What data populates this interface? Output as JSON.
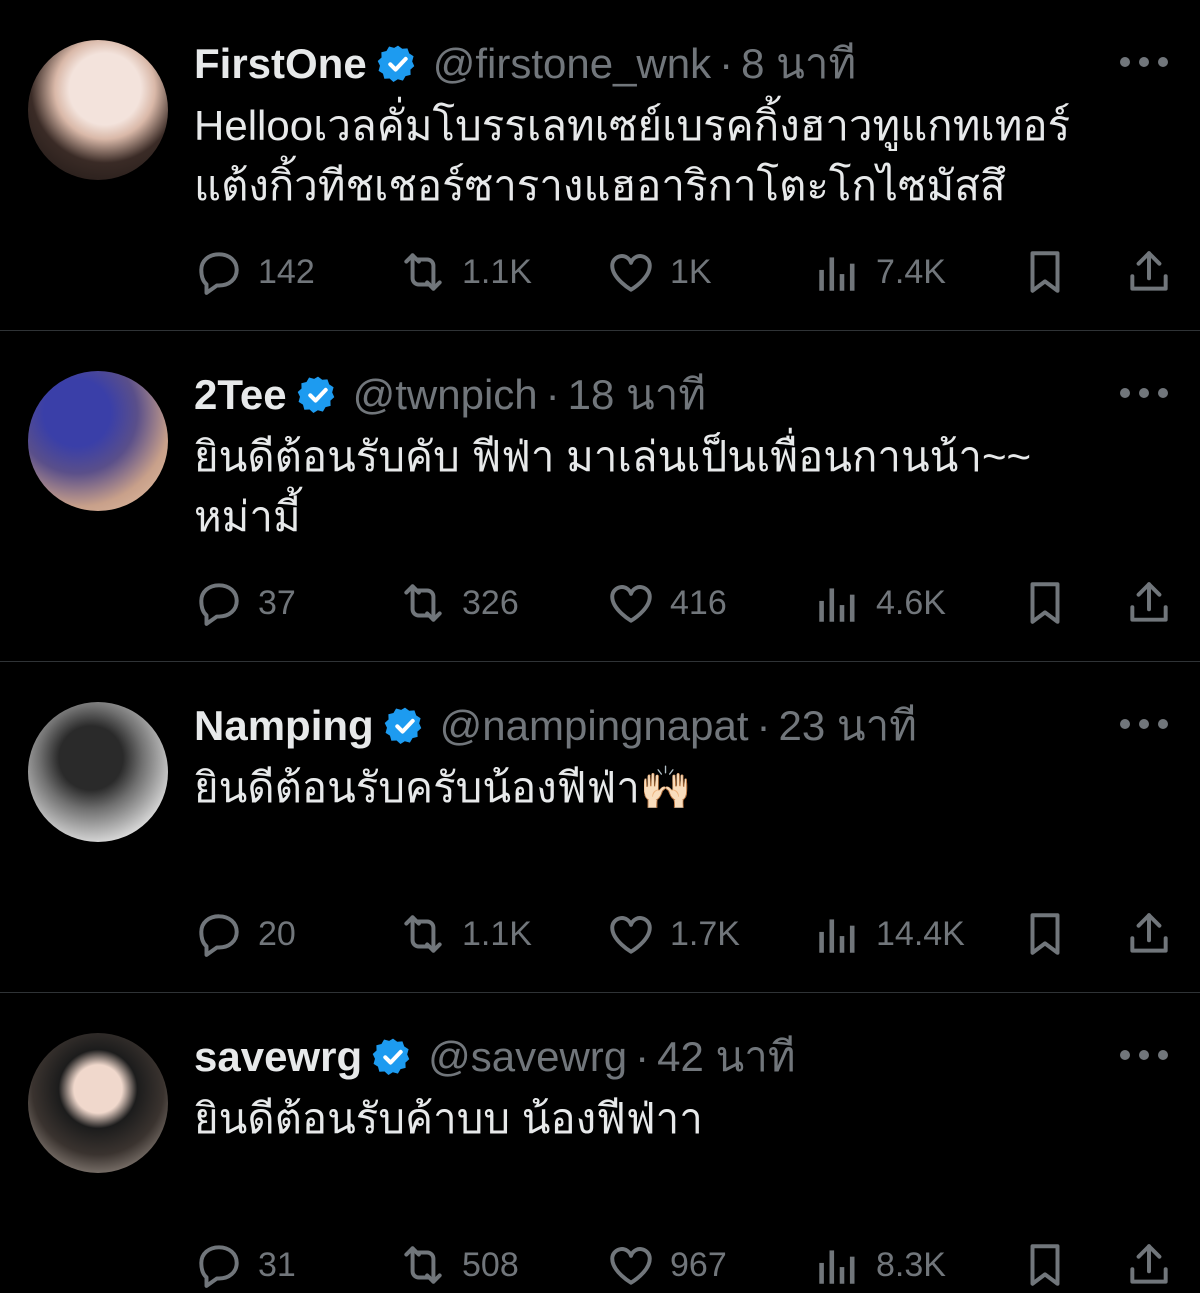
{
  "colors": {
    "background": "#000000",
    "text": "#e7e9ea",
    "muted": "#71767b",
    "verified": "#1d9bf0",
    "divider": "#2f3336"
  },
  "tweets": [
    {
      "name": "FirstOne",
      "handle": "@firstone_wnk",
      "separator": "·",
      "time": "8 นาที",
      "text_lines": [
        "Hellooเวลคั่มโบรรเลทเซย์เบรคกิ้งฮาวทูแกทเทอร์",
        "แต้งกิ้วทีชเชอร์ซารางแฮอาริกาโตะโกไซมัสสึ"
      ],
      "stats": {
        "replies": "142",
        "retweets": "1.1K",
        "likes": "1K",
        "views": "7.4K"
      }
    },
    {
      "name": "2Tee",
      "handle": "@twnpich",
      "separator": "·",
      "time": "18 นาที",
      "text_lines": [
        "ยินดีต้อนรับคับ ฟีฟ่า มาเล่นเป็นเพื่อนกานน้า~~",
        "หม่ามี้"
      ],
      "stats": {
        "replies": "37",
        "retweets": "326",
        "likes": "416",
        "views": "4.6K"
      }
    },
    {
      "name": "Namping",
      "handle": "@nampingnapat",
      "separator": "·",
      "time": "23 นาที",
      "text_lines": [
        "ยินดีต้อนรับครับน้องฟีฟ่า🙌🏻"
      ],
      "stats": {
        "replies": "20",
        "retweets": "1.1K",
        "likes": "1.7K",
        "views": "14.4K"
      }
    },
    {
      "name": "savewrg",
      "handle": "@savewrg",
      "separator": "·",
      "time": "42 นาที",
      "text_lines": [
        "ยินดีต้อนรับค้าบบ น้องฟีฟ่าา"
      ],
      "stats": {
        "replies": "31",
        "retweets": "508",
        "likes": "967",
        "views": "8.3K"
      }
    }
  ],
  "icons": {
    "verified": "verified-badge-icon",
    "more": "more-dots-icon",
    "reply": "reply-icon",
    "retweet": "retweet-icon",
    "like": "heart-icon",
    "views": "views-icon",
    "bookmark": "bookmark-icon",
    "share": "share-icon"
  }
}
